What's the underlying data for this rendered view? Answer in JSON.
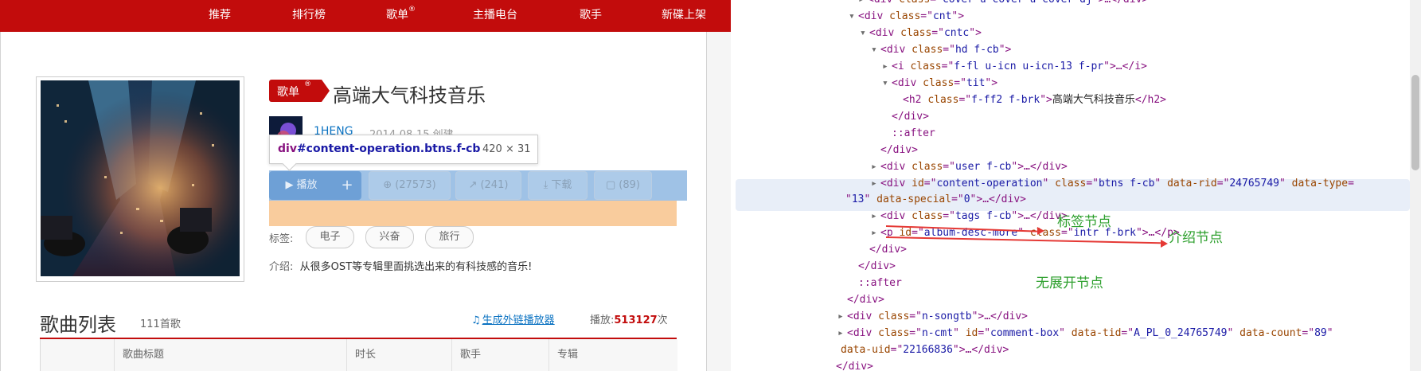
{
  "nav": {
    "items": [
      "推荐",
      "排行榜",
      "歌单",
      "主播电台",
      "歌手",
      "新碟上架"
    ],
    "reg_mark": "®"
  },
  "playlist": {
    "badge": "歌单",
    "badge_reg": "®",
    "title": "高端大气科技音乐",
    "creator": "1HENG",
    "created": "2014-08-15 创建",
    "buttons": {
      "play": "播放",
      "add": "+",
      "collect": "(27573)",
      "share": "(241)",
      "download": "下载",
      "comment": "(89)"
    },
    "tags_label": "标签:",
    "tags": [
      "电子",
      "兴奋",
      "旅行"
    ],
    "intro_label": "介绍:",
    "intro_text": "从很多OST等专辑里面挑选出来的有科技感的音乐!"
  },
  "inspector_tooltip": {
    "selector_tag": "div",
    "selector_rest": "#content-operation.btns.f-cb",
    "size": "420 × 31"
  },
  "song_list": {
    "title": "歌曲列表",
    "count": "111首歌",
    "ext_player_link": "生成外链播放器",
    "plays_label": "播放:",
    "plays_value": "513127",
    "plays_unit": "次",
    "columns": [
      "歌曲标题",
      "时长",
      "歌手",
      "专辑"
    ]
  },
  "annotations": {
    "tag_node": "标签节点",
    "intro_node": "介绍节点",
    "no_expand": "无展开节点"
  },
  "colors": {
    "brand_red": "#c20c0c",
    "link_blue": "#0c73c2",
    "annotation_green": "#2ea02e",
    "arrow_red": "#e53935"
  },
  "icons": [
    "play-icon",
    "collect-icon",
    "share-icon",
    "download-icon",
    "comment-icon",
    "music-note-icon",
    "expand-triangle-icon",
    "collapse-triangle-icon"
  ],
  "dom_tree": [
    {
      "arrow": "▶",
      "html": [
        [
          "p",
          "<"
        ],
        [
          "t",
          "div "
        ],
        [
          "a",
          "class"
        ],
        [
          "p",
          "=\""
        ],
        [
          "v",
          "cover u-cover u-cover-dj"
        ],
        [
          "p",
          "\">…</div>"
        ]
      ]
    },
    {
      "arrow": "▼",
      "html": [
        [
          "p",
          "<"
        ],
        [
          "t",
          "div "
        ],
        [
          "a",
          "class"
        ],
        [
          "p",
          "=\""
        ],
        [
          "v",
          "cnt"
        ],
        [
          "p",
          "\">"
        ]
      ]
    },
    {
      "arrow": "▼",
      "html": [
        [
          "p",
          "<"
        ],
        [
          "t",
          "div "
        ],
        [
          "a",
          "class"
        ],
        [
          "p",
          "=\""
        ],
        [
          "v",
          "cntc"
        ],
        [
          "p",
          "\">"
        ]
      ]
    },
    {
      "arrow": "▼",
      "html": [
        [
          "p",
          "<"
        ],
        [
          "t",
          "div "
        ],
        [
          "a",
          "class"
        ],
        [
          "p",
          "=\""
        ],
        [
          "v",
          "hd f-cb"
        ],
        [
          "p",
          "\">"
        ]
      ]
    },
    {
      "arrow": "▶",
      "html": [
        [
          "p",
          "<"
        ],
        [
          "t",
          "i "
        ],
        [
          "a",
          "class"
        ],
        [
          "p",
          "=\""
        ],
        [
          "v",
          "f-fl u-icn u-icn-13 f-pr"
        ],
        [
          "p",
          "\">…</i>"
        ]
      ]
    },
    {
      "arrow": "▼",
      "html": [
        [
          "p",
          "<"
        ],
        [
          "t",
          "div "
        ],
        [
          "a",
          "class"
        ],
        [
          "p",
          "=\""
        ],
        [
          "v",
          "tit"
        ],
        [
          "p",
          "\">"
        ]
      ]
    },
    {
      "arrow": "",
      "html": [
        [
          "p",
          "<"
        ],
        [
          "t",
          "h2 "
        ],
        [
          "a",
          "class"
        ],
        [
          "p",
          "=\""
        ],
        [
          "v",
          "f-ff2 f-brk"
        ],
        [
          "p",
          "\">"
        ],
        [
          "x",
          "高端大气科技音乐"
        ],
        [
          "p",
          "</h2>"
        ]
      ]
    },
    {
      "arrow": "",
      "html": [
        [
          "p",
          "</div>"
        ]
      ]
    },
    {
      "arrow": "",
      "html": [
        [
          "p",
          "::after"
        ]
      ]
    },
    {
      "arrow": "",
      "html": [
        [
          "p",
          "</div>"
        ]
      ]
    },
    {
      "arrow": "▶",
      "html": [
        [
          "p",
          "<"
        ],
        [
          "t",
          "div "
        ],
        [
          "a",
          "class"
        ],
        [
          "p",
          "=\""
        ],
        [
          "v",
          "user f-cb"
        ],
        [
          "p",
          "\">…</div>"
        ]
      ]
    },
    {
      "arrow": "▶",
      "html": [
        [
          "p",
          "<"
        ],
        [
          "t",
          "div "
        ],
        [
          "a",
          "id"
        ],
        [
          "p",
          "=\""
        ],
        [
          "v",
          "content-operation"
        ],
        [
          "p",
          "\" "
        ],
        [
          "a",
          "class"
        ],
        [
          "p",
          "=\""
        ],
        [
          "v",
          "btns f-cb"
        ],
        [
          "p",
          "\" "
        ],
        [
          "a",
          "data-rid"
        ],
        [
          "p",
          "=\""
        ],
        [
          "v",
          "24765749"
        ],
        [
          "p",
          "\" "
        ],
        [
          "a",
          "data-type"
        ],
        [
          "p",
          "="
        ]
      ]
    },
    {
      "arrow": "",
      "html": [
        [
          "p",
          "\""
        ],
        [
          "v",
          "13"
        ],
        [
          "p",
          "\" "
        ],
        [
          "a",
          "data-special"
        ],
        [
          "p",
          "=\""
        ],
        [
          "v",
          "0"
        ],
        [
          "p",
          "\">…</div>"
        ]
      ]
    },
    {
      "arrow": "▶",
      "html": [
        [
          "p",
          "<"
        ],
        [
          "t",
          "div "
        ],
        [
          "a",
          "class"
        ],
        [
          "p",
          "=\""
        ],
        [
          "v",
          "tags f-cb"
        ],
        [
          "p",
          "\">…</div>"
        ]
      ]
    },
    {
      "arrow": "▶",
      "html": [
        [
          "p",
          "<"
        ],
        [
          "t",
          "p "
        ],
        [
          "a",
          "id"
        ],
        [
          "p",
          "=\""
        ],
        [
          "v",
          "album-desc-more"
        ],
        [
          "p",
          "\" "
        ],
        [
          "a",
          "class"
        ],
        [
          "p",
          "=\""
        ],
        [
          "v",
          "intr f-brk"
        ],
        [
          "p",
          "\">…</p>"
        ]
      ]
    },
    {
      "arrow": "",
      "html": [
        [
          "p",
          "</div>"
        ]
      ]
    },
    {
      "arrow": "",
      "html": [
        [
          "p",
          "</div>"
        ]
      ]
    },
    {
      "arrow": "",
      "html": [
        [
          "p",
          "::after"
        ]
      ]
    },
    {
      "arrow": "",
      "html": [
        [
          "p",
          "</div>"
        ]
      ]
    },
    {
      "arrow": "▶",
      "html": [
        [
          "p",
          "<"
        ],
        [
          "t",
          "div "
        ],
        [
          "a",
          "class"
        ],
        [
          "p",
          "=\""
        ],
        [
          "v",
          "n-songtb"
        ],
        [
          "p",
          "\">…</div>"
        ]
      ]
    },
    {
      "arrow": "▶",
      "html": [
        [
          "p",
          "<"
        ],
        [
          "t",
          "div "
        ],
        [
          "a",
          "class"
        ],
        [
          "p",
          "=\""
        ],
        [
          "v",
          "n-cmt"
        ],
        [
          "p",
          "\" "
        ],
        [
          "a",
          "id"
        ],
        [
          "p",
          "=\""
        ],
        [
          "v",
          "comment-box"
        ],
        [
          "p",
          "\" "
        ],
        [
          "a",
          "data-tid"
        ],
        [
          "p",
          "=\""
        ],
        [
          "v",
          "A_PL_0_24765749"
        ],
        [
          "p",
          "\" "
        ],
        [
          "a",
          "data-count"
        ],
        [
          "p",
          "=\""
        ],
        [
          "v",
          "89"
        ],
        [
          "p",
          "\""
        ]
      ]
    },
    {
      "arrow": "",
      "html": [
        [
          "a",
          "data-uid"
        ],
        [
          "p",
          "=\""
        ],
        [
          "v",
          "22166836"
        ],
        [
          "p",
          "\">…</div>"
        ]
      ]
    },
    {
      "arrow": "",
      "html": [
        [
          "p",
          "</div>"
        ]
      ]
    }
  ]
}
